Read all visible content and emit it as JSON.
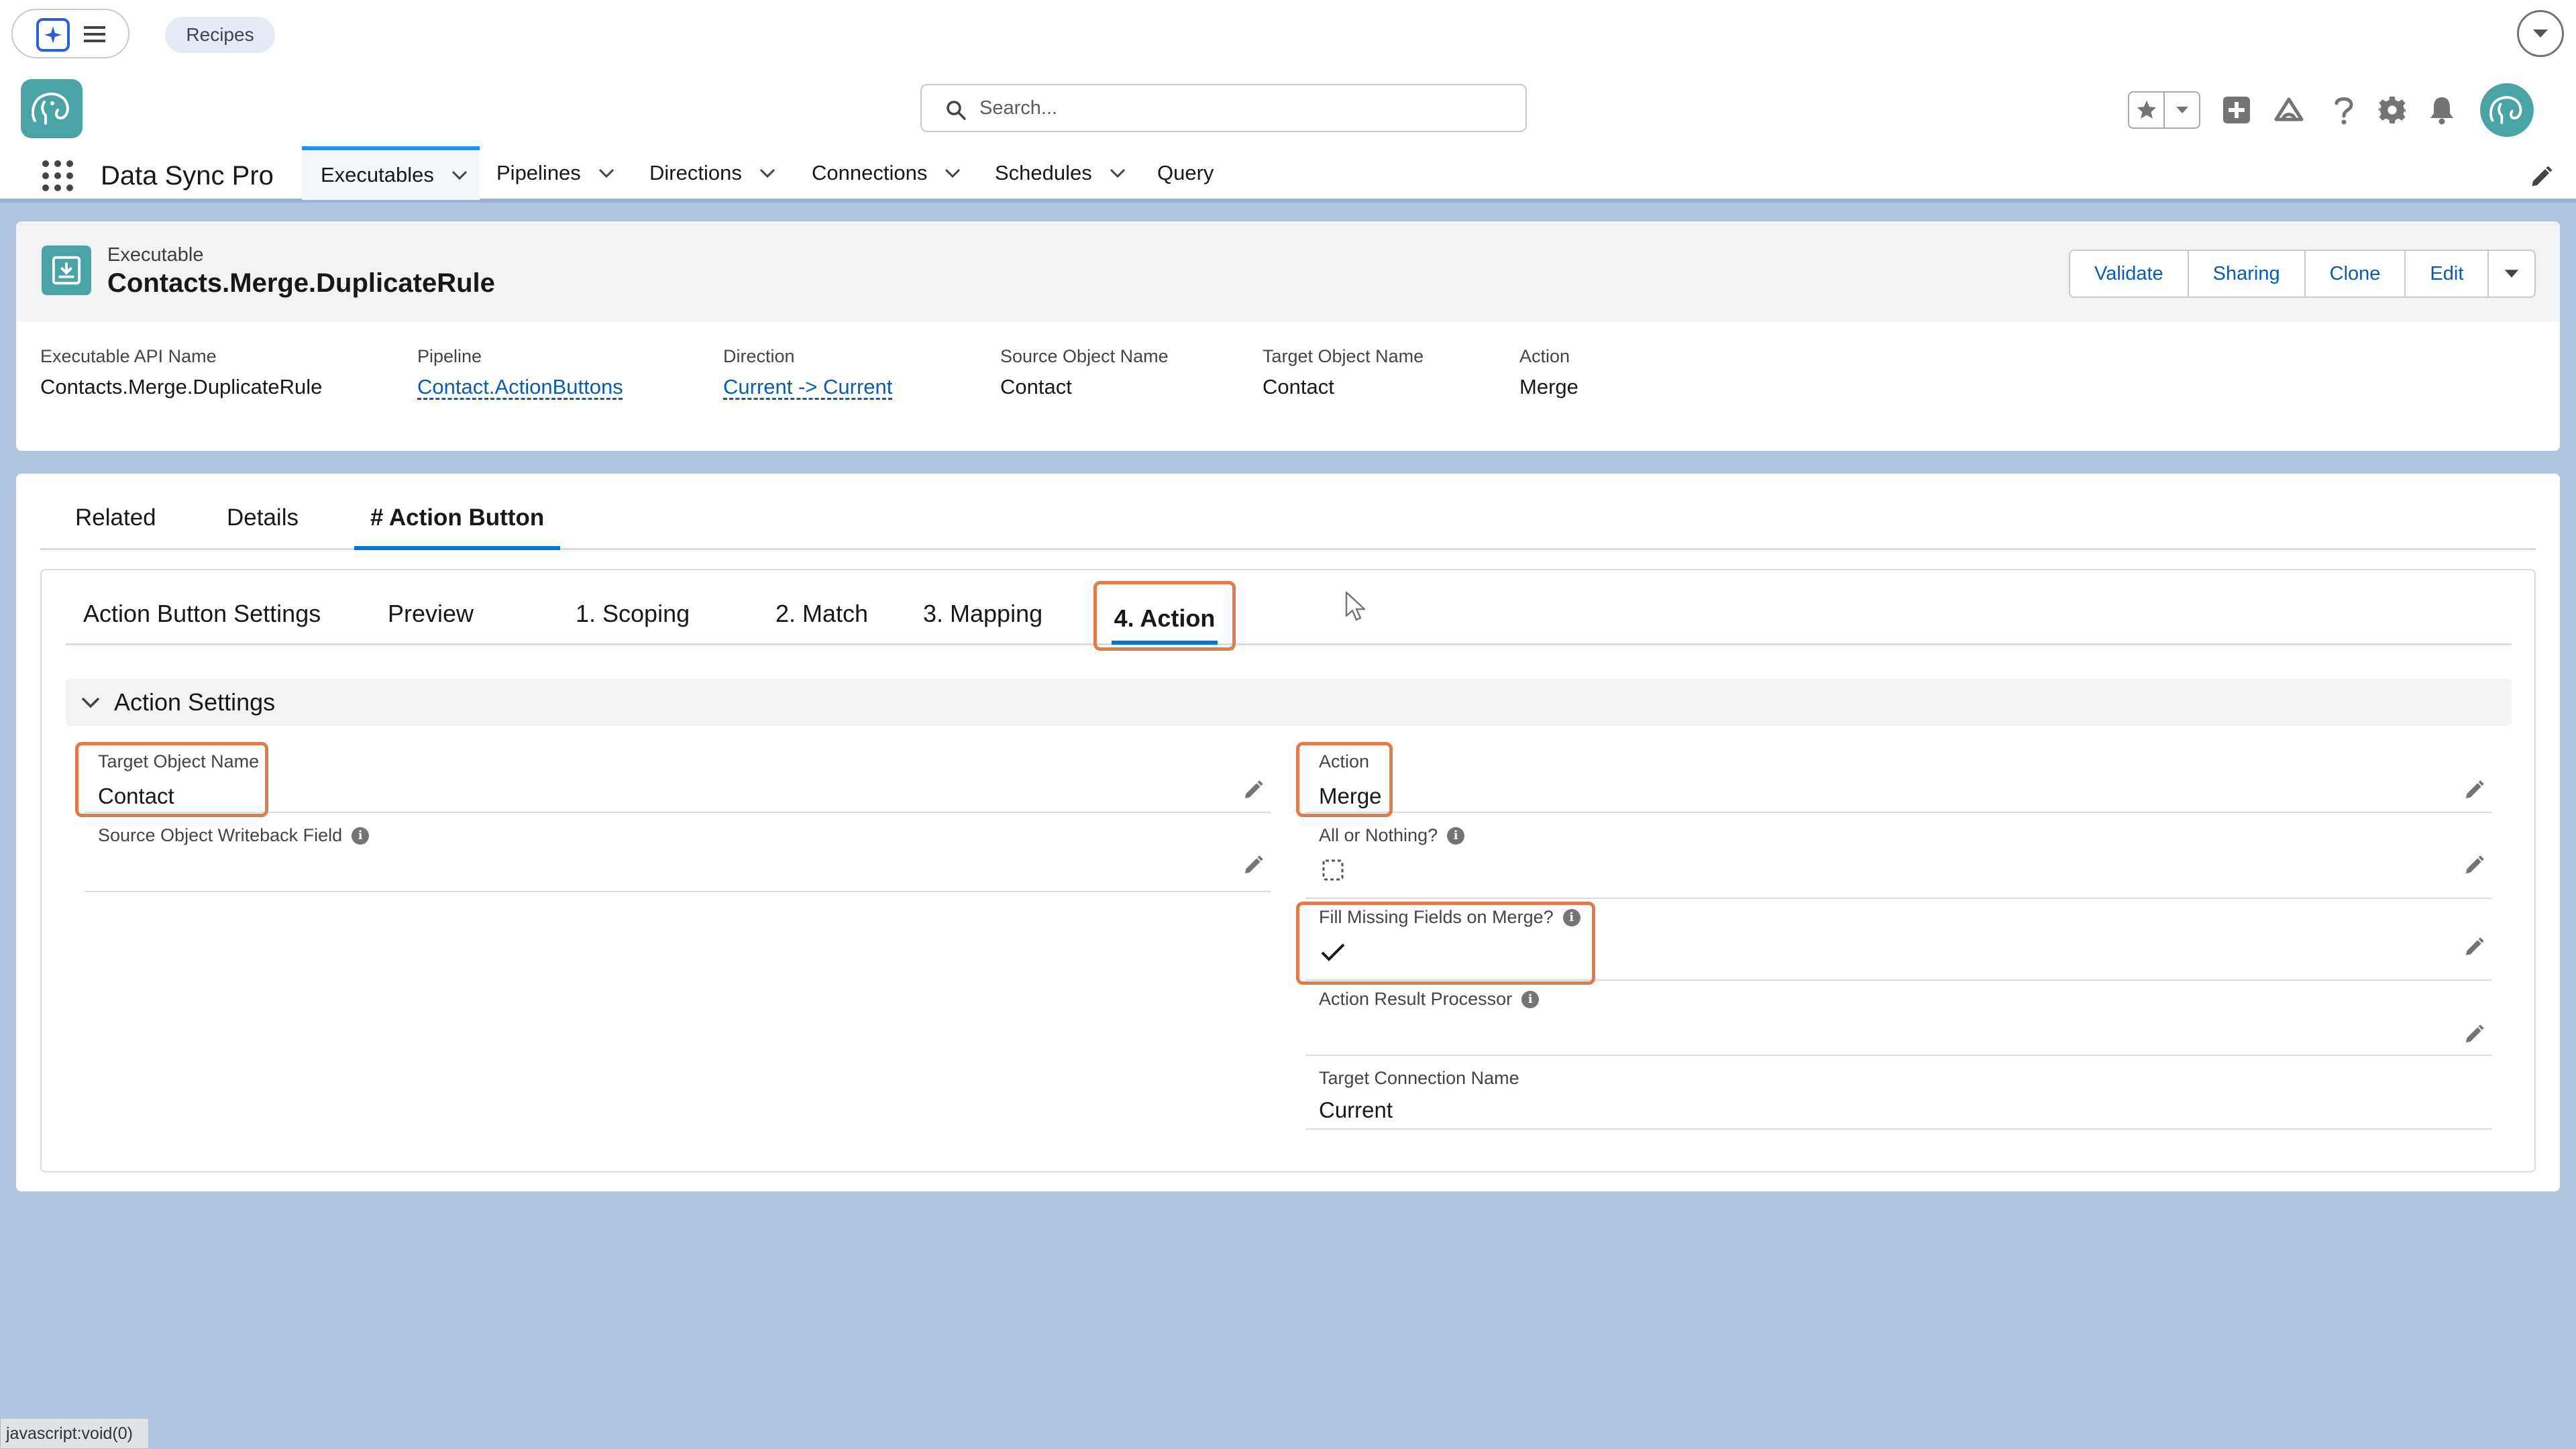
{
  "topbar": {
    "recipes_label": "Recipes"
  },
  "header": {
    "search_placeholder": "Search...",
    "app_name": "Data Sync Pro"
  },
  "nav": {
    "items": [
      {
        "label": "Executables",
        "active": true,
        "has_menu": true
      },
      {
        "label": "Pipelines",
        "has_menu": true
      },
      {
        "label": "Directions",
        "has_menu": true
      },
      {
        "label": "Connections",
        "has_menu": true
      },
      {
        "label": "Schedules",
        "has_menu": true
      },
      {
        "label": "Query",
        "has_menu": false
      }
    ]
  },
  "record": {
    "type_label": "Executable",
    "title": "Contacts.Merge.DuplicateRule",
    "actions": [
      "Validate",
      "Sharing",
      "Clone",
      "Edit"
    ],
    "fields": [
      {
        "label": "Executable API Name",
        "value": "Contacts.Merge.DuplicateRule",
        "link": false
      },
      {
        "label": "Pipeline",
        "value": "Contact.ActionButtons",
        "link": true
      },
      {
        "label": "Direction",
        "value": "Current -> Current",
        "link": true
      },
      {
        "label": "Source Object Name",
        "value": "Contact",
        "link": false
      },
      {
        "label": "Target Object Name",
        "value": "Contact",
        "link": false
      },
      {
        "label": "Action",
        "value": "Merge",
        "link": false
      }
    ]
  },
  "tabs": {
    "items": [
      "Related",
      "Details",
      "# Action Button"
    ],
    "active": "# Action Button"
  },
  "subtabs": {
    "items": [
      "Action Button Settings",
      "Preview",
      "1. Scoping",
      "2. Match",
      "3. Mapping",
      "4. Action"
    ],
    "active": "4. Action"
  },
  "section": {
    "title": "Action Settings",
    "left_fields": [
      {
        "label": "Target Object Name",
        "value": "Contact"
      },
      {
        "label": "Source Object Writeback Field",
        "value": ""
      }
    ],
    "right_fields": [
      {
        "label": "Action",
        "value": "Merge"
      },
      {
        "label": "All or Nothing?",
        "checked": false
      },
      {
        "label": "Fill Missing Fields on Merge?",
        "checked": true
      },
      {
        "label": "Action Result Processor",
        "value": ""
      },
      {
        "label": "Target Connection Name",
        "value": "Current"
      }
    ]
  },
  "status_bar": {
    "text": "javascript:void(0)"
  },
  "colors": {
    "brand_teal": "#4aa4a6",
    "link_blue": "#0b5cab",
    "active_tab_blue": "#0176d3",
    "highlight_orange": "#e07b4a",
    "page_background": "#b0c4df"
  }
}
